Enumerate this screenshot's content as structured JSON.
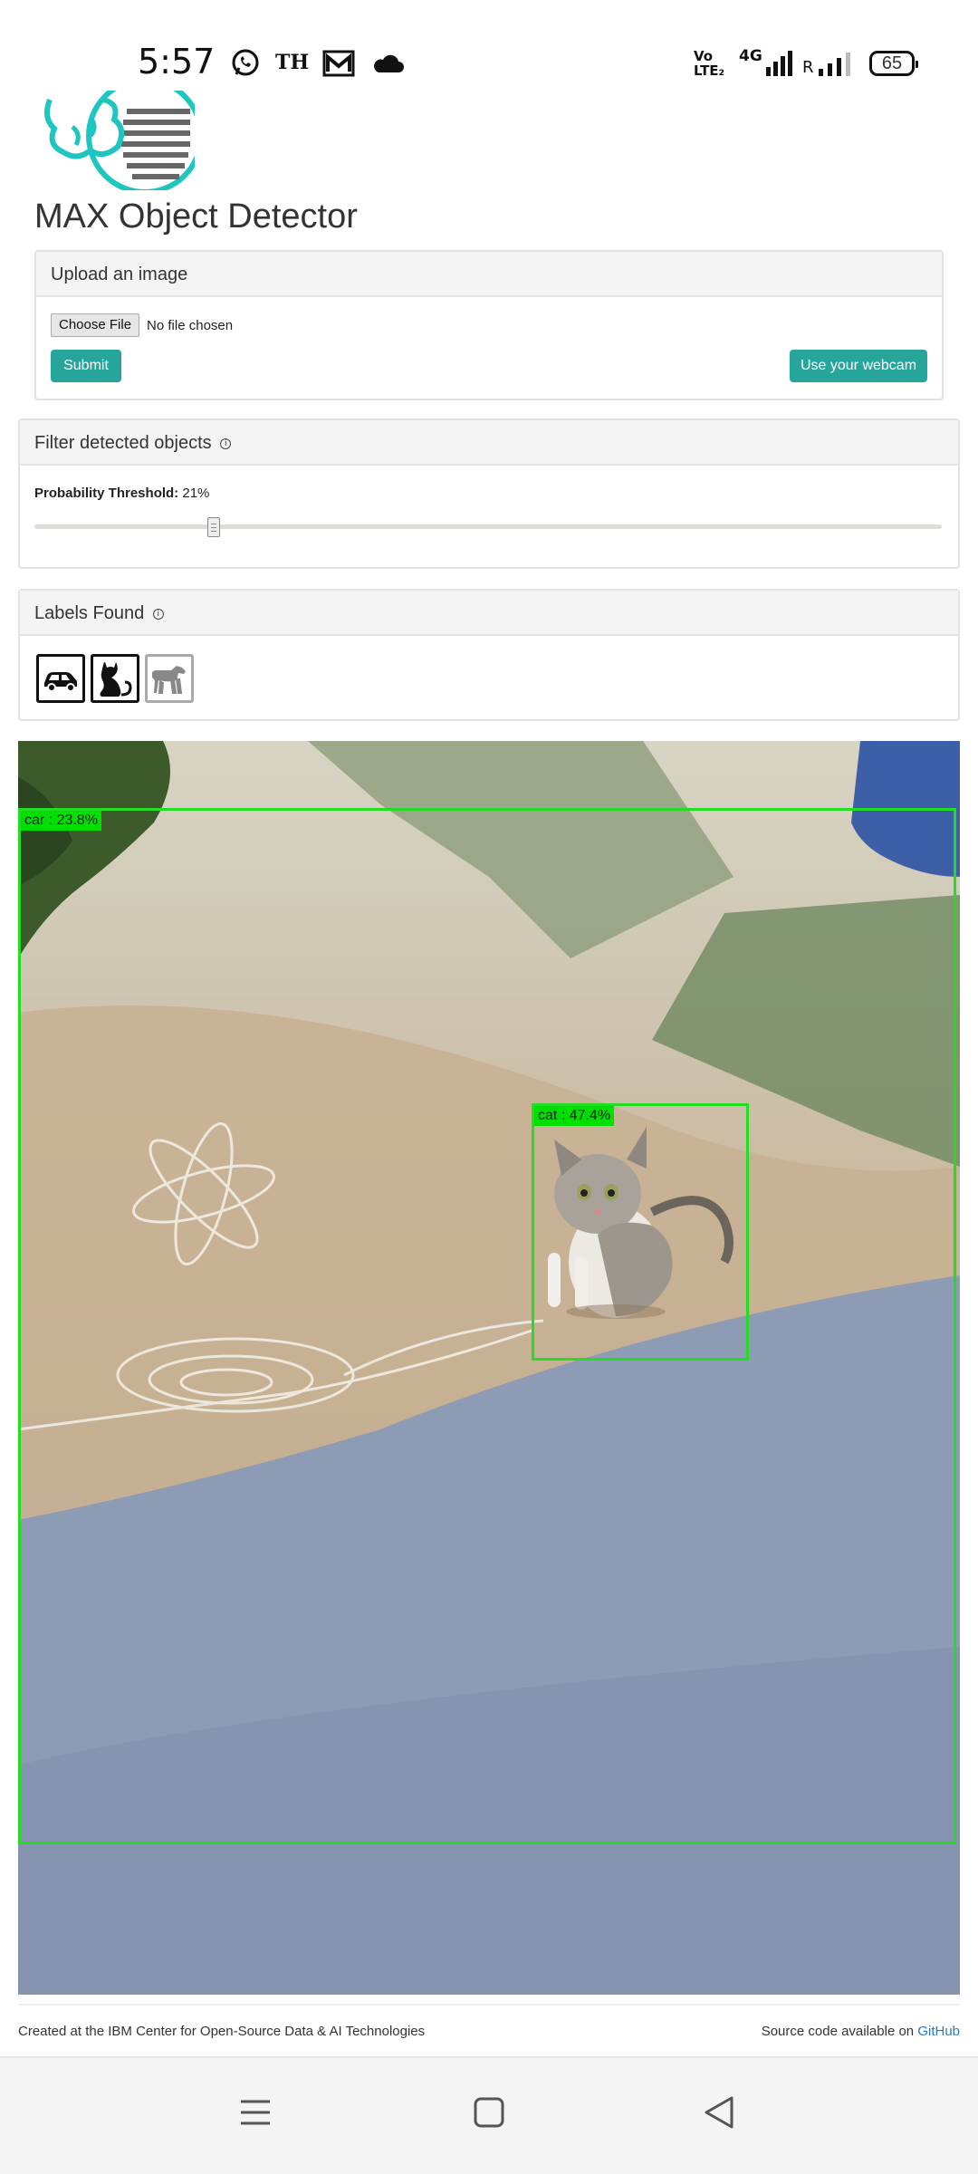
{
  "status_bar": {
    "time": "5:57",
    "notification_text": "TH",
    "network_label_top": "Vo",
    "network_label_bottom": "LTE₂",
    "network_type": "4G",
    "roaming": "R",
    "battery": "65",
    "icons": [
      "whatsapp-icon",
      "gmail-icon",
      "cloud-icon",
      "signal-icon",
      "battery-icon"
    ]
  },
  "app": {
    "title": "MAX Object Detector",
    "accent_color": "#26a69a"
  },
  "upload": {
    "header": "Upload an image",
    "choose_file_label": "Choose File",
    "file_status": "No file chosen",
    "submit_label": "Submit",
    "webcam_label": "Use your webcam"
  },
  "filter": {
    "header": "Filter detected objects",
    "threshold_label": "Probability Threshold:",
    "threshold_value": "21%",
    "threshold_fraction": 0.21
  },
  "labels": {
    "header": "Labels Found",
    "items": [
      {
        "name": "car",
        "icon": "car-icon",
        "active": true
      },
      {
        "name": "cat",
        "icon": "cat-icon",
        "active": true
      },
      {
        "name": "dog",
        "icon": "dog-icon",
        "active": false
      }
    ]
  },
  "detections": [
    {
      "label": "car : 23.8%",
      "color": "#00e000"
    },
    {
      "label": "cat : 47.4%",
      "color": "#00e000"
    }
  ],
  "footer": {
    "left_text": "Created at the IBM Center for Open-Source Data & AI Technologies",
    "right_text": "Source code available on ",
    "link_text": "GitHub"
  },
  "nav_bar": {
    "icons": [
      "menu-icon",
      "home-icon",
      "back-icon"
    ]
  }
}
